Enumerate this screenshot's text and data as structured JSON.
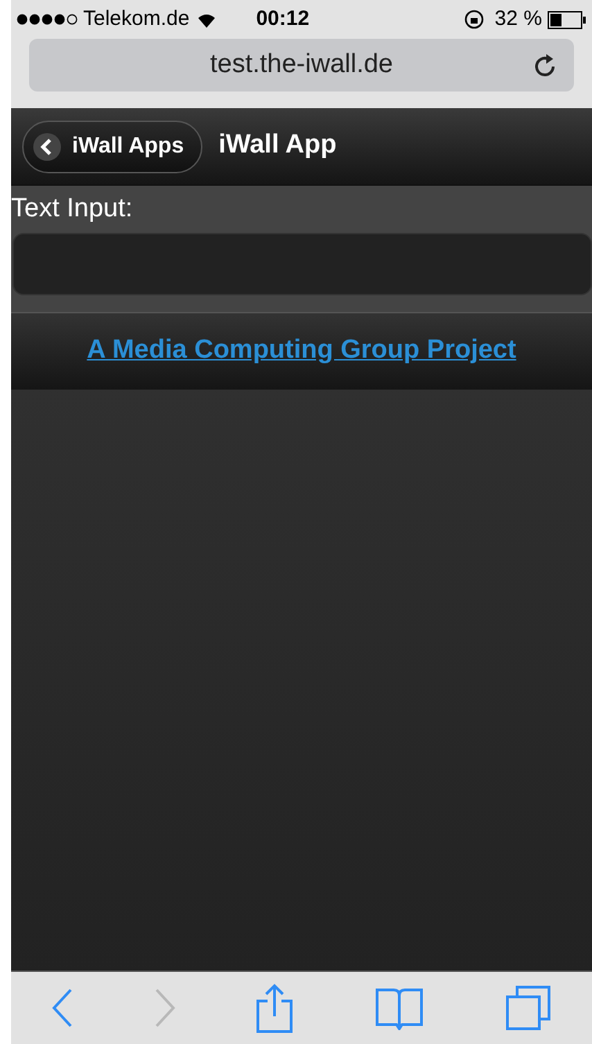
{
  "status_bar": {
    "carrier": "Telekom.de",
    "time": "00:12",
    "battery_text": "32 %"
  },
  "address_bar": {
    "url": "test.the-iwall.de"
  },
  "header": {
    "back_button": "iWall Apps",
    "title": "iWall App"
  },
  "form": {
    "label": "Text Input:"
  },
  "footer_link": "A Media Computing Group Project",
  "toolbar": [
    {
      "kind": "back",
      "disabled": false
    },
    {
      "kind": "forward",
      "disabled": true
    },
    {
      "kind": "share",
      "disabled": false
    },
    {
      "kind": "bookmarks",
      "disabled": false
    },
    {
      "kind": "tabs",
      "disabled": false
    }
  ]
}
